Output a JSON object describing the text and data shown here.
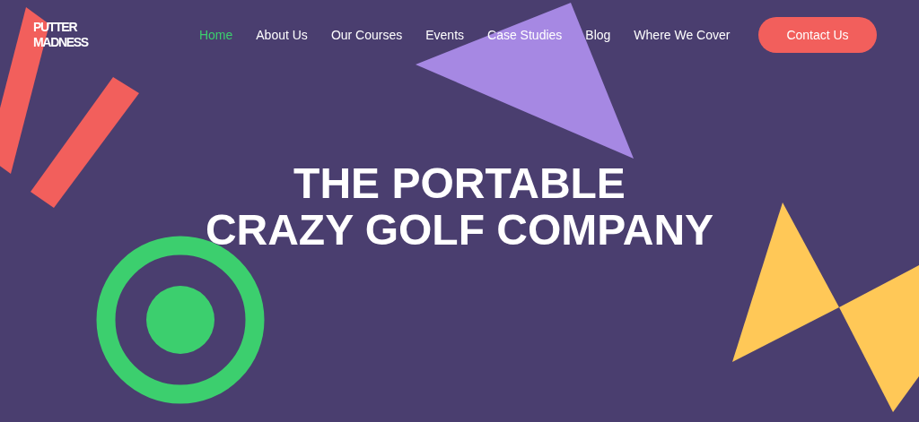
{
  "logo": {
    "lines": [
      "PUTTER",
      "MADNESS"
    ]
  },
  "nav": [
    {
      "label": "Home",
      "selected": true
    },
    {
      "label": "About Us",
      "selected": false
    },
    {
      "label": "Our Courses",
      "selected": false
    },
    {
      "label": "Events",
      "selected": false
    },
    {
      "label": "Case Studies",
      "selected": false
    },
    {
      "label": "Blog",
      "selected": false
    },
    {
      "label": "Where We Cover",
      "selected": false
    }
  ],
  "cta": "Contact Us",
  "hero": {
    "lines": [
      "THE PORTABLE",
      "CRAZY GOLF COMPANY"
    ]
  }
}
